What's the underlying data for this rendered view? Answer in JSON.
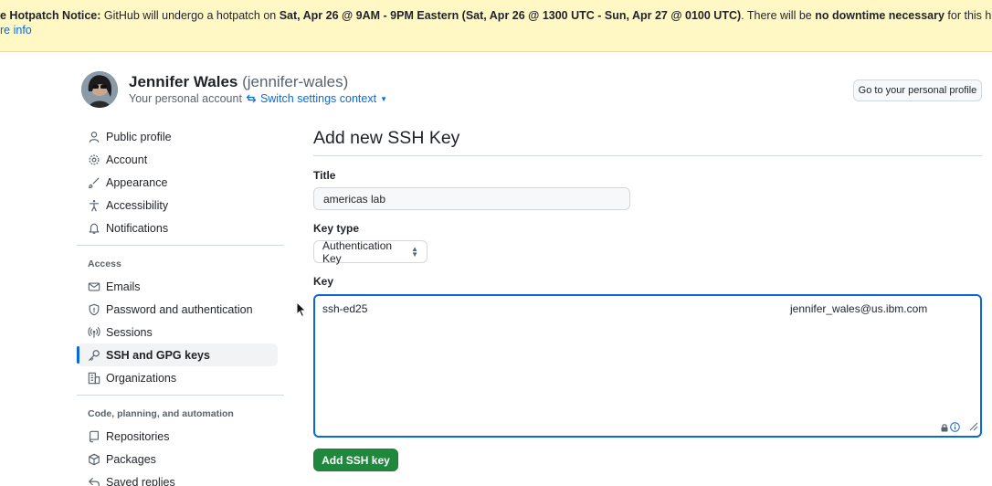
{
  "banner": {
    "prefix": "e Hotpatch Notice:",
    "text1": " GitHub will undergo a hotpatch on ",
    "time1": "Sat, Apr 26 @ 9AM - 9PM Eastern (Sat, Apr 26 @ 1300 UTC - Sun, Apr 27 @ 0100 UTC)",
    "text2": ". There will be ",
    "emph": "no downtime necessary",
    "text3": " for this hotpatch.",
    "more_link": "re info"
  },
  "user": {
    "name": "Jennifer Wales",
    "handle": "(jennifer-wales)",
    "subtitle": "Your personal account",
    "switch_context": "Switch settings context"
  },
  "profile_button": "Go to your personal profile",
  "nav": {
    "group1": [
      {
        "label": "Public profile",
        "icon": "person-icon"
      },
      {
        "label": "Account",
        "icon": "gear-icon"
      },
      {
        "label": "Appearance",
        "icon": "paintbrush-icon"
      },
      {
        "label": "Accessibility",
        "icon": "accessibility-icon"
      },
      {
        "label": "Notifications",
        "icon": "bell-icon"
      }
    ],
    "access_heading": "Access",
    "group2": [
      {
        "label": "Emails",
        "icon": "mail-icon"
      },
      {
        "label": "Password and authentication",
        "icon": "shield-icon"
      },
      {
        "label": "Sessions",
        "icon": "broadcast-icon"
      },
      {
        "label": "SSH and GPG keys",
        "icon": "key-icon",
        "active": true
      },
      {
        "label": "Organizations",
        "icon": "organization-icon"
      }
    ],
    "code_heading": "Code, planning, and automation",
    "group3": [
      {
        "label": "Repositories",
        "icon": "repo-icon"
      },
      {
        "label": "Packages",
        "icon": "package-icon"
      },
      {
        "label": "Saved replies",
        "icon": "reply-icon"
      }
    ]
  },
  "form": {
    "heading": "Add new SSH Key",
    "title_label": "Title",
    "title_value": "americas lab",
    "key_type_label": "Key type",
    "key_type_value": "Authentication Key",
    "key_label": "Key",
    "key_value_start": "ssh-ed25",
    "key_value_end": "jennifer_wales@us.ibm.com",
    "submit_label": "Add SSH key"
  },
  "colors": {
    "accent": "#0969da",
    "banner_bg": "#fff8c5",
    "primary_button": "#1f883d"
  }
}
